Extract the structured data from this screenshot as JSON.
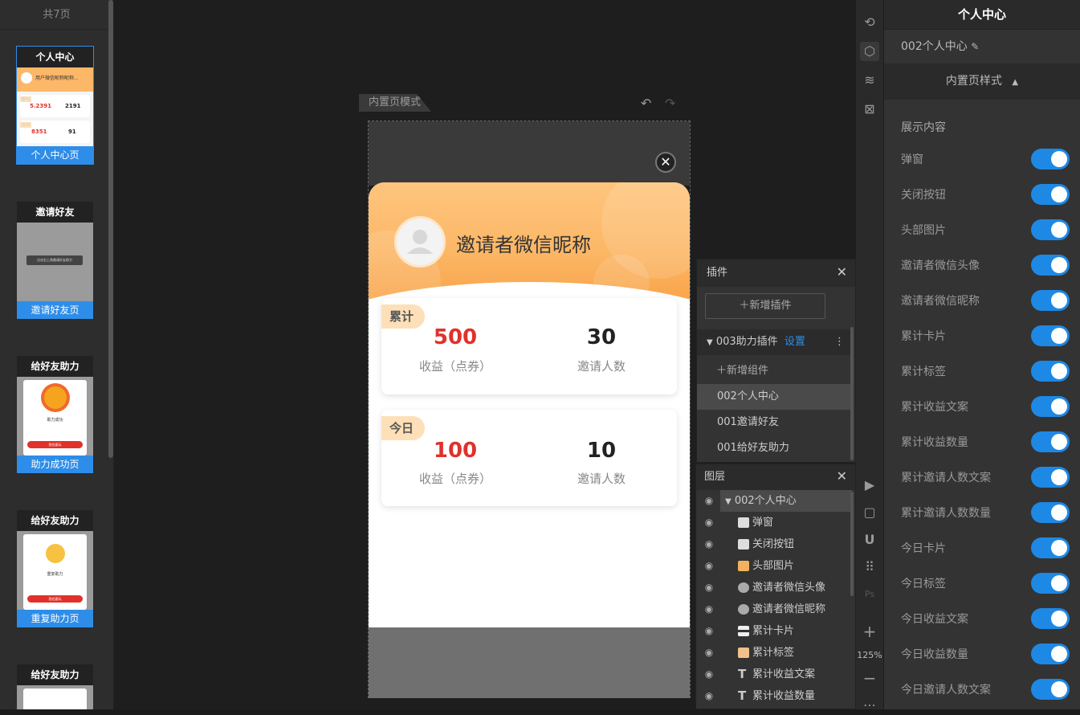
{
  "left_panel": {
    "header": "共7页",
    "pages": [
      {
        "title": "个人中心",
        "caption": "个人中心页",
        "preview_nick": "用户微信昵称昵称...",
        "preview_total_tag": "累计",
        "preview_today_tag": "今日",
        "preview_total_income": "5.2391",
        "preview_total_invites": "2191",
        "preview_today_income": "8351",
        "preview_today_invites": "91"
      },
      {
        "title": "邀请好友",
        "caption": "邀请好友页",
        "preview_button": "点击右上角邀请好友助力"
      },
      {
        "title": "给好友助力",
        "caption": "助力成功页",
        "preview_heading": "助力成功",
        "preview_button": "我也要玩"
      },
      {
        "title": "给好友助力",
        "caption": "重复助力页",
        "preview_heading": "重复助力",
        "preview_button": "我也要玩"
      },
      {
        "title": "给好友助力",
        "caption": ""
      }
    ]
  },
  "canvas": {
    "mode_tab": "内置页模式",
    "undo_icon": "undo-icon",
    "redo_icon": "redo-icon",
    "phone": {
      "close_glyph": "✕",
      "nickname": "邀请者微信昵称",
      "cards": [
        {
          "tag": "累计",
          "income_value": "500",
          "income_label": "收益（点券）",
          "invites_value": "30",
          "invites_label": "邀请人数"
        },
        {
          "tag": "今日",
          "income_value": "100",
          "income_label": "收益（点券）",
          "invites_value": "10",
          "invites_label": "邀请人数"
        }
      ]
    }
  },
  "plugin_panel": {
    "title": "插件",
    "add_plugin": "新增插件",
    "plugin_name": "003助力插件",
    "plugin_settings": "设置",
    "add_component": "新增组件",
    "items": [
      "002个人中心",
      "001邀请好友",
      "001给好友助力"
    ]
  },
  "layer_panel": {
    "title": "图层",
    "root": "002个人中心",
    "items": [
      "弹窗",
      "关闭按钮",
      "头部图片",
      "邀请者微信头像",
      "邀请者微信昵称",
      "累计卡片",
      "累计标签",
      "累计收益文案",
      "累计收益数量"
    ]
  },
  "tools": {
    "zoom": "125%"
  },
  "right_panel": {
    "title": "个人中心",
    "page_name": "002个人中心",
    "section": "内置页样式",
    "show_content": "展示内容",
    "toggles": [
      "弹窗",
      "关闭按钮",
      "头部图片",
      "邀请者微信头像",
      "邀请者微信昵称",
      "累计卡片",
      "累计标签",
      "累计收益文案",
      "累计收益数量",
      "累计邀请人数文案",
      "累计邀请人数数量",
      "今日卡片",
      "今日标签",
      "今日收益文案",
      "今日收益数量",
      "今日邀请人数文案"
    ]
  },
  "colors": {
    "accent": "#1e88e5",
    "income_red": "#e0312b",
    "header_orange": "#fcb868"
  }
}
